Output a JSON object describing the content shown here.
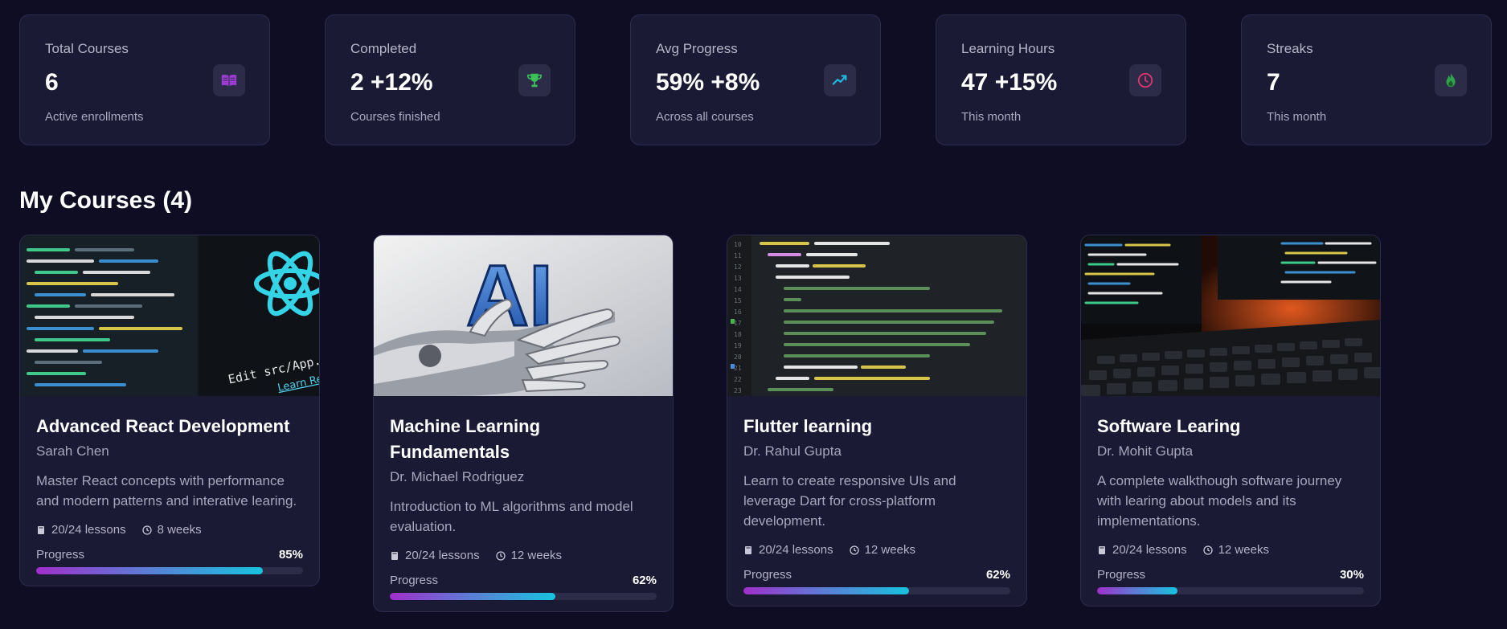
{
  "stats": [
    {
      "label": "Total Courses",
      "value": "6",
      "sub": "Active enrollments",
      "icon": "book-icon",
      "icon_color": "#9b3bd1"
    },
    {
      "label": "Completed",
      "value": "2 +12%",
      "sub": "Courses finished",
      "icon": "trophy-icon",
      "icon_color": "#3bbf59"
    },
    {
      "label": "Avg Progress",
      "value": "59% +8%",
      "sub": "Across all courses",
      "icon": "trending-up-icon",
      "icon_color": "#1fb7e0"
    },
    {
      "label": "Learning Hours",
      "value": "47 +15%",
      "sub": "This month",
      "icon": "clock-icon",
      "icon_color": "#e0336f"
    },
    {
      "label": "Streaks",
      "value": "7",
      "sub": "This month",
      "icon": "flame-icon",
      "icon_color": "#2fa34c"
    }
  ],
  "section_title": "My Courses (4)",
  "courses": [
    {
      "title": "Advanced React Development",
      "instructor": "Sarah Chen",
      "description": "Master React concepts with performance and modern patterns and interative learing.",
      "lessons": "20/24 lessons",
      "duration": "8 weeks",
      "progress_label": "Progress",
      "progress_text": "85%",
      "progress": 0.85,
      "thumb": "react-code",
      "thumb_text_1": "Edit src/App.js and save",
      "thumb_text_2": "Learn React"
    },
    {
      "title": "Machine Learning Fundamentals",
      "instructor": "Dr. Michael Rodriguez",
      "description": "Introduction to ML algorithms and model evaluation.",
      "lessons": "20/24 lessons",
      "duration": "12 weeks",
      "progress_label": "Progress",
      "progress_text": "62%",
      "progress": 0.62,
      "thumb": "ai-hand",
      "thumb_text_1": "AI"
    },
    {
      "title": "Flutter learning",
      "instructor": "Dr. Rahul Gupta",
      "description": "Learn to create responsive UIs and leverage Dart for cross-platform development.",
      "lessons": "20/24 lessons",
      "duration": "12 weeks",
      "progress_label": "Progress",
      "progress_text": "62%",
      "progress": 0.62,
      "thumb": "flutter-code"
    },
    {
      "title": "Software Learing",
      "instructor": "Dr. Mohit Gupta",
      "description": "A complete walkthough software journey with learing about models and its implementations.",
      "lessons": "20/24 lessons",
      "duration": "12 weeks",
      "progress_label": "Progress",
      "progress_text": "30%",
      "progress": 0.3,
      "thumb": "keyboard-monitor"
    }
  ]
}
